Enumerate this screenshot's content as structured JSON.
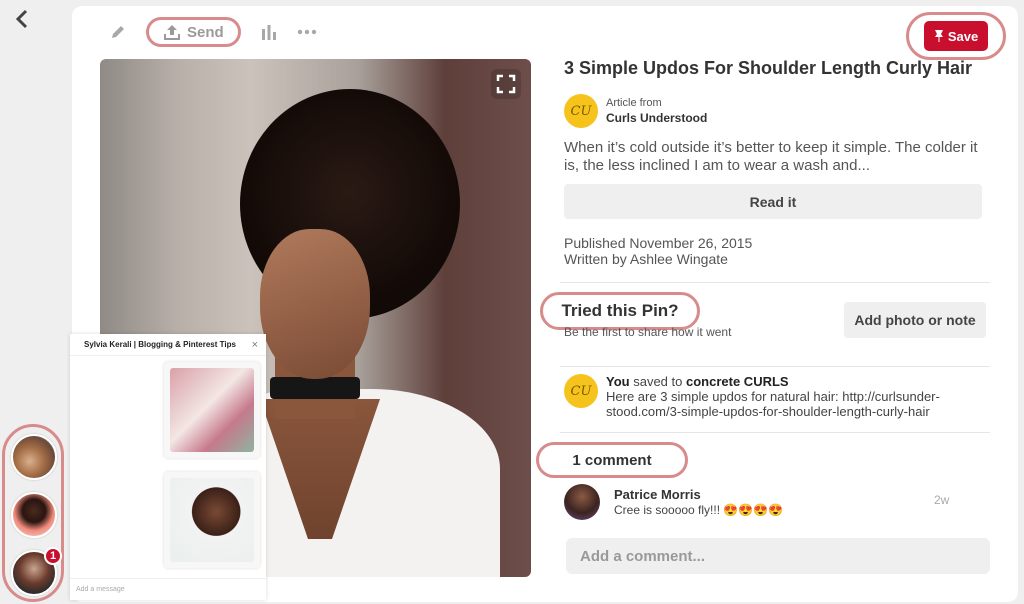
{
  "toolbar": {
    "send_label": "Send",
    "save_label": "Save"
  },
  "pin": {
    "title": "3 Simple Updos For Shoulder Length Curly Hair",
    "source_logo_text": "CU",
    "source_prefix": "Article from",
    "source_name": "Curls Understood",
    "description": "When it’s cold outside it’s better to keep it simple. The colder it is, the less inclined I am to wear a wash and...",
    "read_button": "Read it",
    "published": "Published November 26, 2015",
    "author": "Written by Ashlee Wingate"
  },
  "tried": {
    "title": "Tried this Pin?",
    "subtitle": "Be the first to share how it went",
    "add_button": "Add photo or note"
  },
  "saved": {
    "logo_text": "CU",
    "you": "You",
    "saved_to": "saved to",
    "board": "concrete CURLS",
    "note": "Here are 3 simple updos for natural hair: http://curlsunder-stood.com/3-simple-updos-for-shoulder-length-curly-hair"
  },
  "comments": {
    "title": "1 comment",
    "items": [
      {
        "name": "Patrice Morris",
        "text": "Cree is sooooo fly!!! 😍😍😍😍",
        "time": "2w"
      }
    ],
    "placeholder": "Add a comment..."
  },
  "chat": {
    "title": "Sylvia Kerali | Blogging & Pinterest Tips",
    "close": "×",
    "placeholder": "Add a message"
  },
  "notifications": {
    "badge": "1"
  },
  "colors": {
    "save_red": "#c8102e",
    "highlight_ring": "#d88b8b",
    "source_yellow": "#f5c31c"
  }
}
